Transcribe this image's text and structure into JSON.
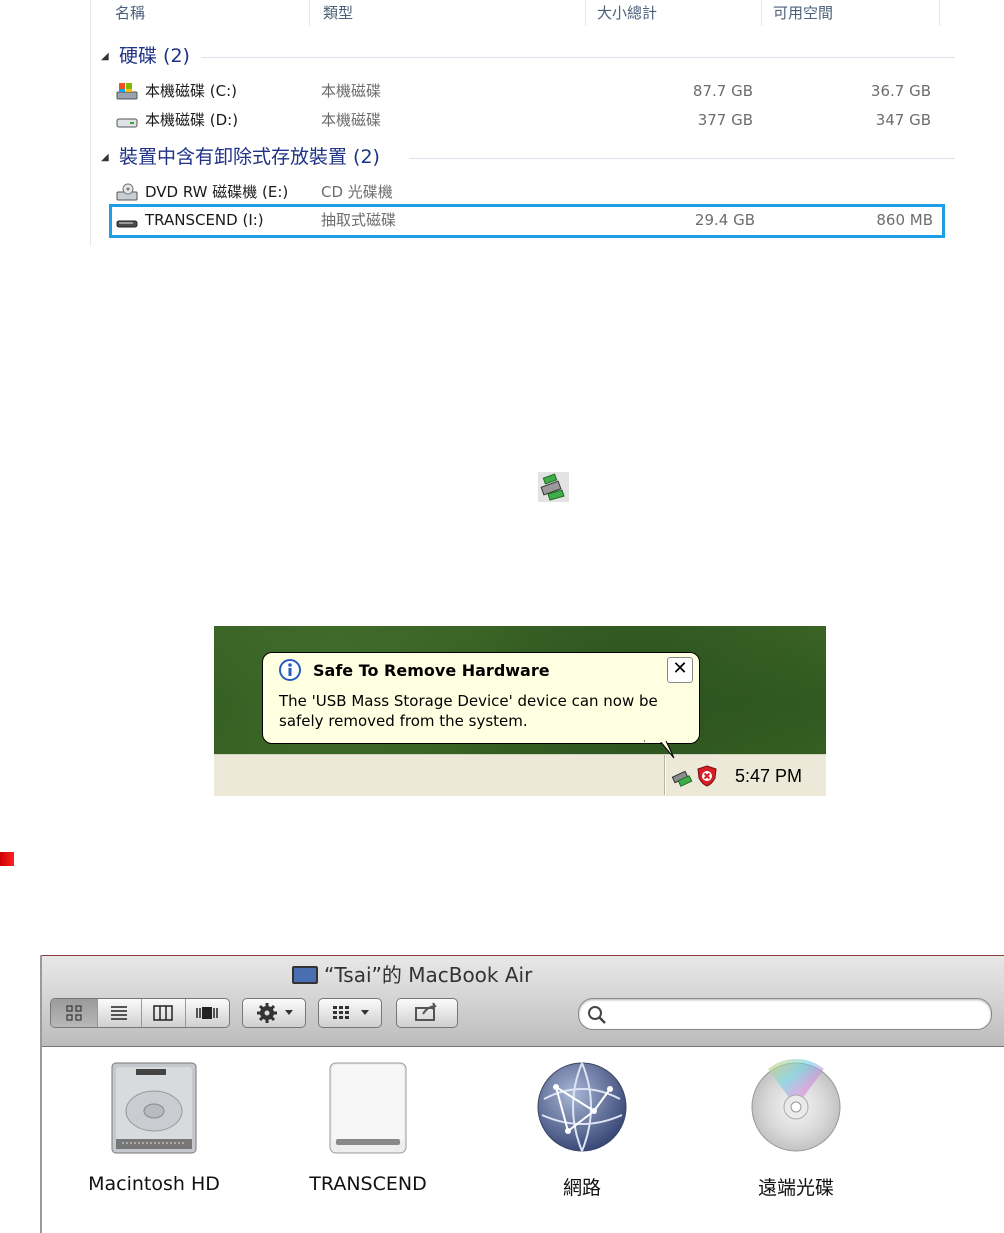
{
  "explorer": {
    "columns": [
      "名稱",
      "類型",
      "大小總計",
      "可用空間"
    ],
    "groups": [
      {
        "title": "硬碟 (2)",
        "items": [
          {
            "name": "本機磁碟 (C:)",
            "type": "本機磁碟",
            "size": "87.7 GB",
            "free": "36.7 GB"
          },
          {
            "name": "本機磁碟 (D:)",
            "type": "本機磁碟",
            "size": "377 GB",
            "free": "347 GB"
          }
        ]
      },
      {
        "title": "裝置中含有卸除式存放裝置 (2)",
        "items": [
          {
            "name": "DVD RW 磁碟機 (E:)",
            "type": "CD 光碟機",
            "size": "",
            "free": ""
          },
          {
            "name": "TRANSCEND (I:)",
            "type": "抽取式磁碟",
            "size": "29.4 GB",
            "free": "860 MB"
          }
        ]
      }
    ],
    "highlight_color": "#1e9ee6"
  },
  "xp_balloon": {
    "title": "Safe To Remove Hardware",
    "body": "The 'USB Mass Storage Device' device can now be safely removed from the system.",
    "close": "✕",
    "time": "5:47 PM"
  },
  "finder": {
    "title": "“Tsai”的 MacBook Air",
    "search_placeholder": "",
    "volumes": [
      {
        "label": "Macintosh HD",
        "icon": "hard-drive-icon"
      },
      {
        "label": "TRANSCEND",
        "icon": "external-drive-icon"
      },
      {
        "label": "網路",
        "icon": "network-globe-icon"
      },
      {
        "label": "遠端光碟",
        "icon": "remote-disc-icon"
      }
    ]
  }
}
